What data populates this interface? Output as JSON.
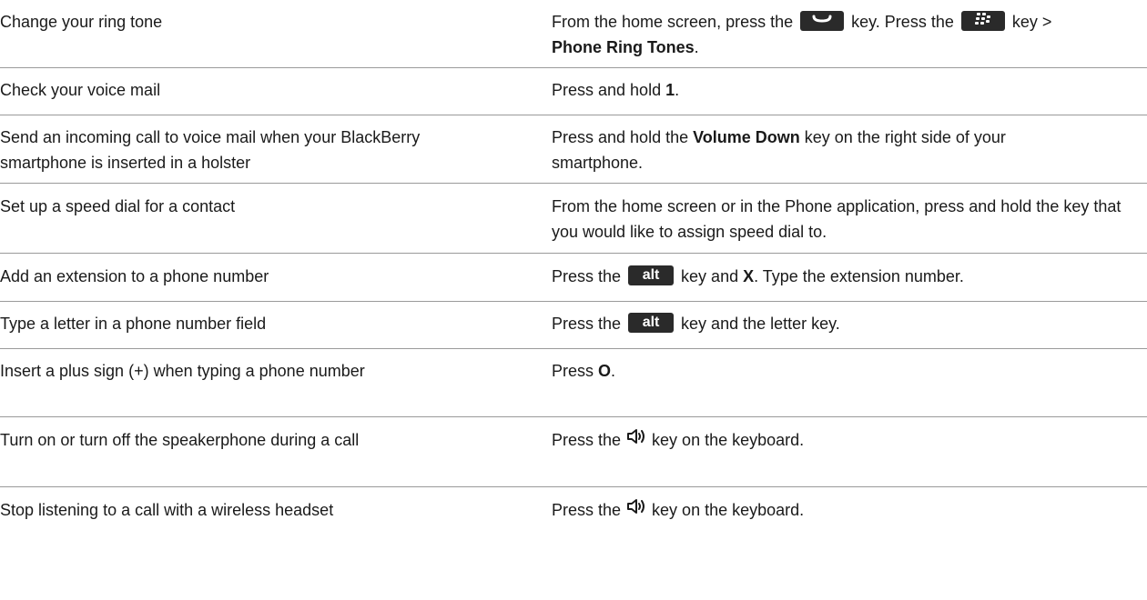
{
  "rows": [
    {
      "task": "Change your ring tone",
      "s1": "From the home screen, press the",
      "s2": "key. Press the",
      "s3": "key >",
      "bold": "Phone Ring Tones",
      "end": "."
    },
    {
      "task": "Check your voice mail",
      "pre": "Press and hold ",
      "bold": "1",
      "end": "."
    },
    {
      "task": "Send an incoming call to voice mail when your BlackBerry smartphone is inserted in a holster",
      "pre": "Press and hold the ",
      "bold": "Volume Down",
      "end": " key on the right side of your smartphone."
    },
    {
      "task": "Set up a speed dial for a contact",
      "text": "From the home screen or in the Phone application, press and hold the key that you would like to assign speed dial to."
    },
    {
      "task": "Add an extension to a phone number",
      "pre": "Press the",
      "key": "alt",
      "mid": "key and ",
      "bold": "X",
      "end": ". Type the extension number."
    },
    {
      "task": "Type a letter in a phone number field",
      "pre": "Press the",
      "key": "alt",
      "end": "key and the letter key."
    },
    {
      "task": "Insert a plus sign (+) when typing a phone number",
      "pre": "Press ",
      "bold": "O",
      "end": "."
    },
    {
      "task": "Turn on or turn off the speakerphone during a call",
      "pre": "Press the",
      "end": "key on the keyboard."
    },
    {
      "task": "Stop listening to a call with a wireless headset",
      "pre": "Press the",
      "end": "key on the keyboard."
    }
  ],
  "icons": {
    "send_key": "send-key-icon",
    "menu_key": "blackberry-menu-key-icon",
    "speaker": "speaker-key-icon"
  }
}
